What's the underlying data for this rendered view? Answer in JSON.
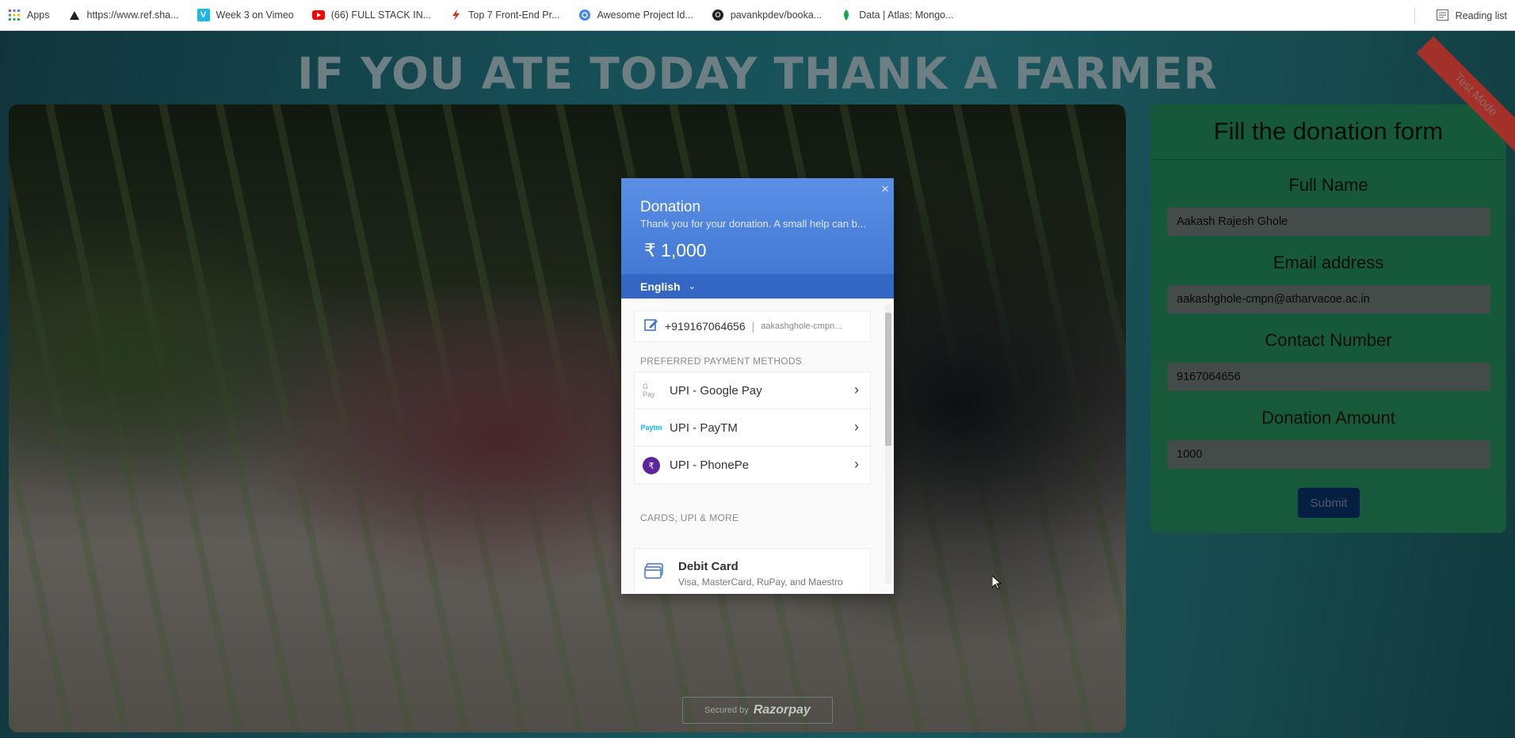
{
  "bookmarks": {
    "items": [
      {
        "label": "Apps",
        "icon": "apps-grid-icon"
      },
      {
        "label": "https://www.ref.sha...",
        "icon": "triangle-icon"
      },
      {
        "label": "Week 3 on Vimeo",
        "icon": "vimeo-icon"
      },
      {
        "label": "(66) FULL STACK IN...",
        "icon": "youtube-icon"
      },
      {
        "label": "Top 7 Front-End Pr...",
        "icon": "lightning-icon"
      },
      {
        "label": "Awesome Project Id...",
        "icon": "globe-icon"
      },
      {
        "label": "pavankpdev/booka...",
        "icon": "github-icon"
      },
      {
        "label": "Data | Atlas: Mongo...",
        "icon": "mongodb-leaf-icon"
      }
    ],
    "reading_list": "Reading list"
  },
  "page": {
    "headline": "IF YOU ATE TODAY THANK A FARMER",
    "test_mode": "Test Mode"
  },
  "form": {
    "title": "Fill the donation form",
    "full_name_label": "Full Name",
    "full_name_value": "Aakash Rajesh Ghole",
    "email_label": "Email address",
    "email_value": "aakashghole-cmpn@atharvacoe.ac.in",
    "contact_label": "Contact Number",
    "contact_value": "9167064656",
    "amount_label": "Donation Amount",
    "amount_value": "1000",
    "submit_label": "Submit"
  },
  "modal": {
    "close": "×",
    "title": "Donation",
    "description": "Thank you for your donation. A small help can b...",
    "amount": "₹ 1,000",
    "language": "English",
    "contact_phone": "+919167064656",
    "contact_email": "aakashghole-cmpn...",
    "preferred_label": "PREFERRED PAYMENT METHODS",
    "methods": [
      {
        "label": "UPI - Google Pay",
        "icon": "google-pay-icon"
      },
      {
        "label": "UPI - PayTM",
        "icon": "paytm-icon"
      },
      {
        "label": "UPI - PhonePe",
        "icon": "phonepe-icon"
      }
    ],
    "cards_label": "CARDS, UPI & MORE",
    "debit_title": "Debit Card",
    "debit_sub": "Visa, MasterCard, RuPay, and Maestro"
  },
  "footer": {
    "secured_by": "Secured by",
    "brand": "Razorpay"
  },
  "colors": {
    "modal_header": "#3e74d0",
    "form_card": "#29a06a",
    "submit": "#0a3a7a",
    "ribbon": "#a4302a"
  }
}
